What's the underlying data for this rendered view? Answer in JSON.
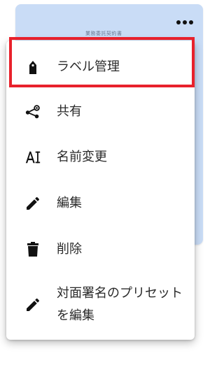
{
  "card": {
    "title": "業務委託契約書"
  },
  "menu": {
    "items": [
      {
        "label": "ラベル管理",
        "icon": "label-tag-icon"
      },
      {
        "label": "共有",
        "icon": "share-icon"
      },
      {
        "label": "名前変更",
        "icon": "rename-text-icon"
      },
      {
        "label": "編集",
        "icon": "pencil-icon"
      },
      {
        "label": "削除",
        "icon": "trash-icon"
      },
      {
        "label": "対面署名のプリセットを編集",
        "icon": "pencil-icon"
      }
    ]
  },
  "colors": {
    "card_bg": "#c9dcf6",
    "highlight_border": "#e8212c",
    "icon": "#111111"
  }
}
